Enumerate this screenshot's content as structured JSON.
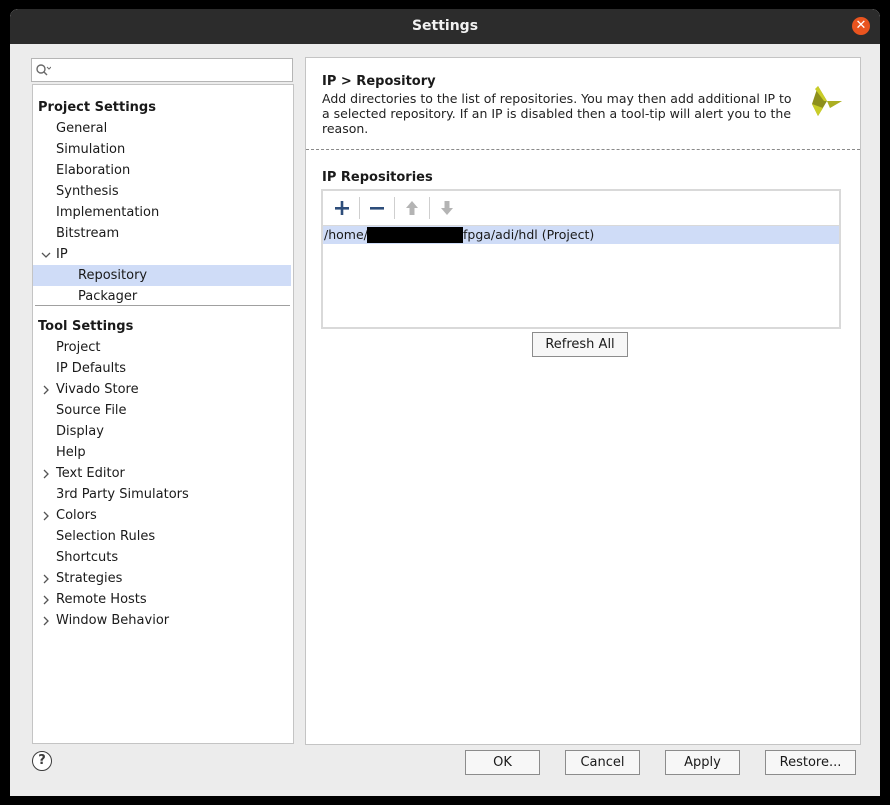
{
  "window": {
    "title": "Settings"
  },
  "search": {
    "placeholder": "",
    "value": ""
  },
  "tree": {
    "project_settings_label": "Project Settings",
    "project_items": [
      {
        "label": "General",
        "expandable": false
      },
      {
        "label": "Simulation",
        "expandable": false
      },
      {
        "label": "Elaboration",
        "expandable": false
      },
      {
        "label": "Synthesis",
        "expandable": false
      },
      {
        "label": "Implementation",
        "expandable": false
      },
      {
        "label": "Bitstream",
        "expandable": false
      },
      {
        "label": "IP",
        "expandable": true,
        "expanded": true
      }
    ],
    "ip_children": [
      {
        "label": "Repository",
        "selected": true
      },
      {
        "label": "Packager",
        "selected": false
      }
    ],
    "tool_settings_label": "Tool Settings",
    "tool_items": [
      {
        "label": "Project",
        "expandable": false
      },
      {
        "label": "IP Defaults",
        "expandable": false
      },
      {
        "label": "Vivado Store",
        "expandable": true
      },
      {
        "label": "Source File",
        "expandable": false
      },
      {
        "label": "Display",
        "expandable": false
      },
      {
        "label": "Help",
        "expandable": false
      },
      {
        "label": "Text Editor",
        "expandable": true
      },
      {
        "label": "3rd Party Simulators",
        "expandable": false
      },
      {
        "label": "Colors",
        "expandable": true
      },
      {
        "label": "Selection Rules",
        "expandable": false
      },
      {
        "label": "Shortcuts",
        "expandable": false
      },
      {
        "label": "Strategies",
        "expandable": true
      },
      {
        "label": "Remote Hosts",
        "expandable": true
      },
      {
        "label": "Window Behavior",
        "expandable": true
      }
    ]
  },
  "panel": {
    "breadcrumb": "IP > Repository",
    "description": "Add directories to the list of repositories. You may then add additional IP to a selected repository. If an IP is disabled then a tool-tip will alert you to the reason.",
    "repositories_label": "IP Repositories",
    "repositories": [
      {
        "prefix": "/home/",
        "suffix": "fpga/adi/hdl (Project)"
      }
    ],
    "refresh_label": "Refresh All"
  },
  "footer": {
    "help_glyph": "?",
    "ok_label": "OK",
    "cancel_label": "Cancel",
    "apply_label": "Apply",
    "restore_label": "Restore..."
  },
  "colors": {
    "titlebar": "#2c2c2c",
    "close": "#e9541f",
    "selection": "#cfdcf7",
    "logo_dark": "#8d8f1c",
    "logo_light": "#c9cd28"
  },
  "icons": {
    "close": "close-icon",
    "search": "search-icon",
    "expand": "chevron-right-icon",
    "collapse": "chevron-down-icon",
    "add": "plus-icon",
    "remove": "minus-icon",
    "up": "arrow-up-icon",
    "down": "arrow-down-icon",
    "logo": "xilinx-logo-icon"
  }
}
